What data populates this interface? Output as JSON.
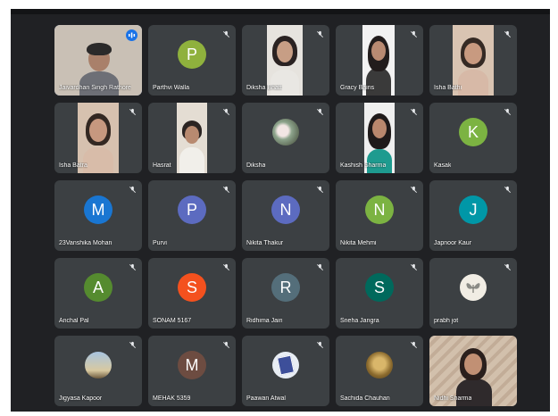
{
  "colors": {
    "background": "#202124",
    "tile": "#3c4043",
    "active_outline": "#8ab4f8",
    "speaking_badge": "#1a73e8"
  },
  "participants": [
    {
      "name": "Jaivardhan Singh Rathore",
      "type": "video",
      "muted": false,
      "speaking": true
    },
    {
      "name": "Parthvi Walla",
      "type": "initial",
      "initial": "P",
      "color": "#8fb13d",
      "muted": true
    },
    {
      "name": "Diksha Bhatt",
      "type": "video",
      "muted": true
    },
    {
      "name": "Gracy Bains",
      "type": "video",
      "muted": true
    },
    {
      "name": "Isha Bathi",
      "type": "video",
      "muted": true
    },
    {
      "name": "Isha Batra",
      "type": "video",
      "muted": true
    },
    {
      "name": "Hasrat",
      "type": "video",
      "muted": true
    },
    {
      "name": "Diksha",
      "type": "photo",
      "muted": true
    },
    {
      "name": "Kashish Sharma",
      "type": "video",
      "muted": true
    },
    {
      "name": "Kasak",
      "type": "initial",
      "initial": "K",
      "color": "#7cb342",
      "muted": true
    },
    {
      "name": "23Vanshika Mohan",
      "type": "initial",
      "initial": "M",
      "color": "#1976d2",
      "muted": true
    },
    {
      "name": "Purvi",
      "type": "initial",
      "initial": "P",
      "color": "#5c6bc0",
      "muted": true
    },
    {
      "name": "Nikita Thakur",
      "type": "initial",
      "initial": "N",
      "color": "#5c6bc0",
      "muted": true
    },
    {
      "name": "Nikita Mehmi",
      "type": "initial",
      "initial": "N",
      "color": "#7cb342",
      "muted": true
    },
    {
      "name": "Japnoor Kaur",
      "type": "initial",
      "initial": "J",
      "color": "#0097a7",
      "muted": true
    },
    {
      "name": "Anchal Pal",
      "type": "initial",
      "initial": "A",
      "color": "#558b2f",
      "muted": true
    },
    {
      "name": "SONAM 5167",
      "type": "initial",
      "initial": "S",
      "color": "#f4511e",
      "muted": true
    },
    {
      "name": "Ridhima Jain",
      "type": "initial",
      "initial": "R",
      "color": "#546e7a",
      "muted": true
    },
    {
      "name": "Sneha Jangra",
      "type": "initial",
      "initial": "S",
      "color": "#00695c",
      "muted": true
    },
    {
      "name": "prabh jot",
      "type": "photo",
      "muted": true
    },
    {
      "name": "Jigyasa Kapoor",
      "type": "photo",
      "muted": true
    },
    {
      "name": "MEHAK 5359",
      "type": "initial",
      "initial": "M",
      "color": "#6d4c41",
      "muted": true
    },
    {
      "name": "Paawan Atwal",
      "type": "photo",
      "muted": true
    },
    {
      "name": "Sachida Chauhan",
      "type": "photo",
      "muted": true
    },
    {
      "name": "Nidhi Sharma",
      "type": "video",
      "muted": false
    }
  ]
}
